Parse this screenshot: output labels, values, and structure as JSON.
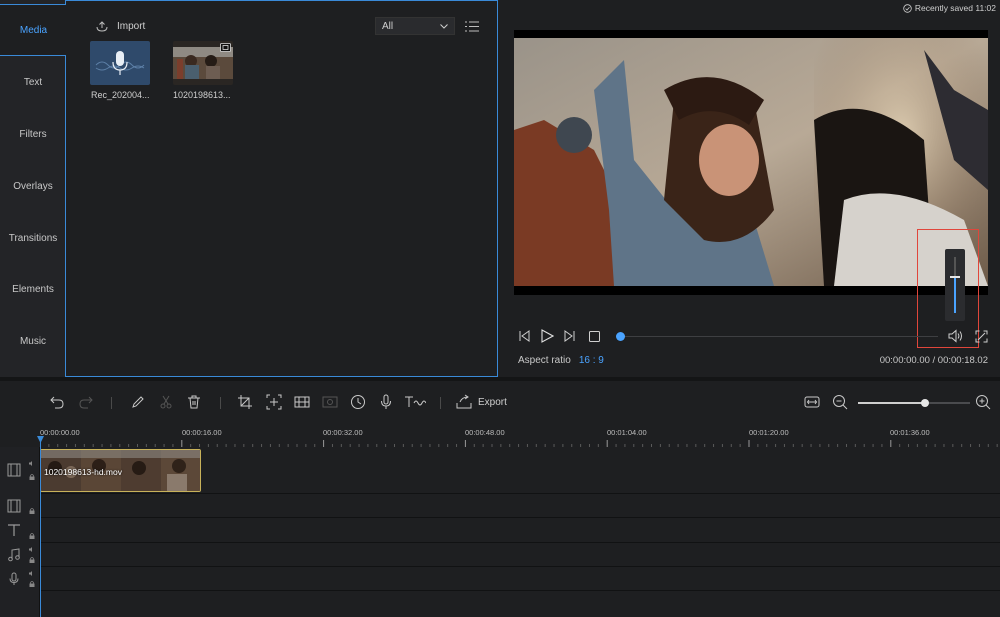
{
  "nav": {
    "items": [
      {
        "label": "Media"
      },
      {
        "label": "Text"
      },
      {
        "label": "Filters"
      },
      {
        "label": "Overlays"
      },
      {
        "label": "Transitions"
      },
      {
        "label": "Elements"
      },
      {
        "label": "Music"
      }
    ]
  },
  "media": {
    "import_label": "Import",
    "filter_value": "All",
    "files": [
      {
        "name": "Rec_202004...",
        "type": "audio"
      },
      {
        "name": "1020198613...",
        "type": "video"
      }
    ]
  },
  "preview": {
    "saved_status": "Recently saved 11:02",
    "aspect_label": "Aspect ratio",
    "aspect_value": "16 : 9",
    "time_display": "00:00:00.00 / 00:00:18.02",
    "progress": 0.0,
    "volume": 0.65
  },
  "toolbar": {
    "export_label": "Export",
    "zoom": 0.6
  },
  "timeline": {
    "ruler_labels": [
      "00:00:00.00",
      "00:00:16.00",
      "00:00:32.00",
      "00:00:48.00",
      "00:01:04.00",
      "00:01:20.00",
      "00:01:36.00"
    ],
    "clip_name": "1020198613-hd.mov"
  },
  "colors": {
    "accent": "#4aa3ff",
    "clip_border": "#c8b25a",
    "highlight_box": "#e0463b"
  }
}
